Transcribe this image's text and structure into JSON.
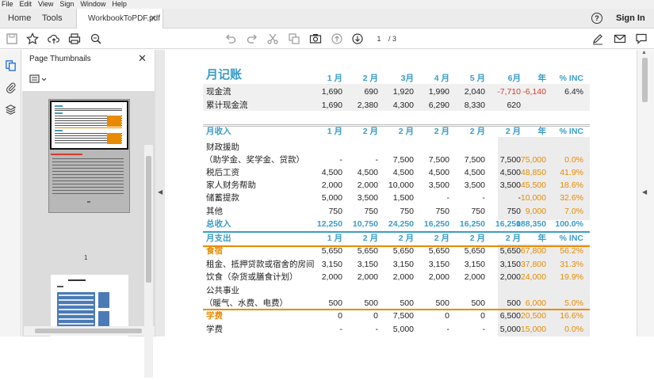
{
  "menu": [
    "File",
    "Edit",
    "View",
    "Sign",
    "Window",
    "Help"
  ],
  "tabs": {
    "home": "Home",
    "tools": "Tools",
    "doc": "WorkbookToPDF.pdf"
  },
  "header": {
    "sign_in": "Sign In",
    "help": "?"
  },
  "paging": {
    "current": "1",
    "total": "/ 3"
  },
  "panel": {
    "title": "Page Thumbnails",
    "thumb_label": "1"
  },
  "sheet": {
    "title": "月记账",
    "months": [
      "1 月",
      "2 月",
      "3月",
      "4 月",
      "5 月",
      "6月"
    ],
    "year_hdr": "年",
    "inc_hdr": "% INC",
    "cashflow": {
      "label": "现金流",
      "vals": [
        "1,690",
        "690",
        "1,920",
        "1,990",
        "2,040",
        "-7,710"
      ],
      "year": "-6,140",
      "inc": "6.4%"
    },
    "cumulative": {
      "label": "累计现金流",
      "vals": [
        "1,690",
        "2,380",
        "4,300",
        "6,290",
        "8,330",
        "620"
      ]
    },
    "income_title": "月收入",
    "income_months": [
      "1 月",
      "2 月",
      "2 月",
      "2 月",
      "2 月",
      "2 月"
    ],
    "income_rows": [
      {
        "label": "财政援助",
        "vals": [
          "",
          "",
          "",
          "",
          "",
          ""
        ],
        "year": "",
        "inc": ""
      },
      {
        "label": "（助学金、奖学金、贷款）",
        "vals": [
          "-",
          "-",
          "7,500",
          "7,500",
          "7,500",
          "7,500"
        ],
        "year": "75,000",
        "inc": "0.0%"
      },
      {
        "label": "税后工资",
        "vals": [
          "4,500",
          "4,500",
          "4,500",
          "4,500",
          "4,500",
          "4,500"
        ],
        "year": "48,850",
        "inc": "41.9%"
      },
      {
        "label": "家人财务帮助",
        "vals": [
          "2,000",
          "2,000",
          "10,000",
          "3,500",
          "3,500",
          "3,500"
        ],
        "year": "45,500",
        "inc": "18.6%"
      },
      {
        "label": "储蓄提款",
        "vals": [
          "5,000",
          "3,500",
          "1,500",
          "-",
          "-",
          "-"
        ],
        "year": "10,000",
        "inc": "32.6%"
      },
      {
        "label": "其他",
        "vals": [
          "750",
          "750",
          "750",
          "750",
          "750",
          "750"
        ],
        "year": "9,000",
        "inc": "7.0%"
      }
    ],
    "income_total": {
      "label": "总收入",
      "vals": [
        "12,250",
        "10,750",
        "24,250",
        "16,250",
        "16,250",
        "16,250"
      ],
      "year": "188,350",
      "inc": "100.0%"
    },
    "expense_title": "月支出",
    "expense_months": [
      "1 月",
      "2 月",
      "2 月",
      "2 月",
      "2 月",
      "2 月"
    ],
    "expense_rows": [
      {
        "label": "食宿",
        "vals": [
          "5,650",
          "5,650",
          "5,650",
          "5,650",
          "5,650",
          "5,650"
        ],
        "year": "67,800",
        "inc": "56.2%",
        "orange": true
      },
      {
        "label": "租金、抵押贷款或宿舍的房间",
        "vals": [
          "3,150",
          "3,150",
          "3,150",
          "3,150",
          "3,150",
          "3,150"
        ],
        "year": "37,800",
        "inc": "31.3%"
      },
      {
        "label": "饮食（杂货或膳食计划）",
        "vals": [
          "2,000",
          "2,000",
          "2,000",
          "2,000",
          "2,000",
          "2,000"
        ],
        "year": "24,000",
        "inc": "19.9%"
      },
      {
        "label": "公共事业",
        "vals": [
          "",
          "",
          "",
          "",
          "",
          ""
        ],
        "year": "",
        "inc": ""
      },
      {
        "label": "（暖气、水费、电费）",
        "vals": [
          "500",
          "500",
          "500",
          "500",
          "500",
          "500"
        ],
        "year": "6,000",
        "inc": "5.0%"
      },
      {
        "label": "学费",
        "vals": [
          "0",
          "0",
          "7,500",
          "0",
          "0",
          "6,500"
        ],
        "year": "20,500",
        "inc": "16.6%",
        "orange": true
      },
      {
        "label": "学费",
        "vals": [
          "-",
          "-",
          "5,000",
          "-",
          "-",
          "5,000"
        ],
        "year": "15,000",
        "inc": "0.0%"
      }
    ]
  }
}
